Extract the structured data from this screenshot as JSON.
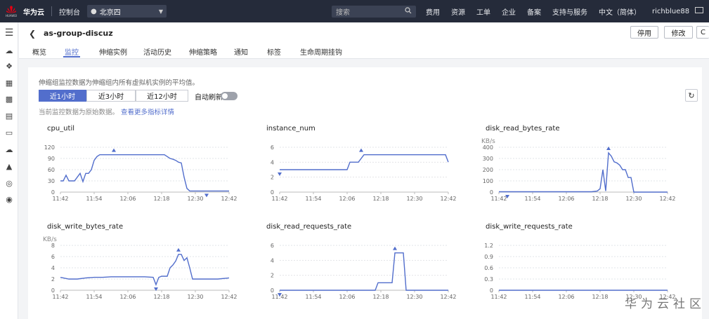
{
  "topbar": {
    "logo_text": "HUAWEI",
    "brand": "华为云",
    "console": "控制台",
    "region": "北京四",
    "search_placeholder": "搜索",
    "nav": [
      "费用",
      "资源",
      "工单",
      "企业",
      "备案",
      "支持与服务",
      "中文（简体）",
      "richblue88"
    ]
  },
  "header": {
    "group_name": "as-group-discuz",
    "stop_label": "停用",
    "edit_label": "修改",
    "tabs": [
      "概览",
      "监控",
      "伸缩实例",
      "活动历史",
      "伸缩策略",
      "通知",
      "标签",
      "生命周期挂钩"
    ],
    "active_tab": "监控"
  },
  "monitor": {
    "description": "伸缩组监控数据为伸缩组内所有虚拟机实例的平均值。",
    "ranges": [
      "近1小时",
      "近3小时",
      "近12小时"
    ],
    "active_range": "近1小时",
    "auto_refresh_label": "自动刷新",
    "auto_refresh_on": false,
    "note": "当前监控数据为原始数据。",
    "note_link": "查看更多指标详情"
  },
  "watermark": "华为云社区",
  "chart_data": [
    {
      "type": "line",
      "title": "cpu_util",
      "ylabel": "",
      "x_ticks": [
        "11:42",
        "11:54",
        "12:06",
        "12:18",
        "12:30",
        "12:42"
      ],
      "y_ticks": [
        "0",
        "30",
        "60",
        "90",
        "120"
      ],
      "ylim": [
        0,
        120
      ],
      "xlim": [
        0,
        60
      ],
      "series": [
        {
          "name": "",
          "color": "#526ecc",
          "x": [
            0,
            1,
            2,
            3,
            4,
            5,
            6,
            7,
            8,
            9,
            10,
            11,
            12,
            13,
            14,
            15,
            16,
            17,
            18,
            19,
            20,
            21,
            22,
            23,
            24,
            25,
            26,
            27,
            28,
            29,
            30,
            31,
            32,
            33,
            34,
            35,
            36,
            37,
            38,
            39,
            40,
            41,
            42,
            43,
            44,
            45,
            46,
            47,
            48,
            49,
            50,
            51,
            52,
            53,
            54,
            55,
            56,
            57,
            58,
            59,
            60
          ],
          "y": [
            30,
            30,
            45,
            30,
            30,
            30,
            40,
            50,
            28,
            50,
            50,
            60,
            85,
            95,
            100,
            100,
            100,
            100,
            100,
            100,
            100,
            100,
            100,
            100,
            100,
            100,
            100,
            100,
            100,
            100,
            100,
            100,
            100,
            100,
            100,
            100,
            100,
            100,
            95,
            90,
            88,
            85,
            80,
            78,
            40,
            10,
            3,
            3,
            3,
            3,
            3,
            3,
            3,
            3,
            3,
            3,
            3,
            3,
            3,
            3,
            3
          ]
        }
      ],
      "max_marker_x": 19,
      "min_marker_x": 52
    },
    {
      "type": "line",
      "title": "instance_num",
      "ylabel": "",
      "x_ticks": [
        "11:42",
        "11:54",
        "12:06",
        "12:18",
        "12:30",
        "12:42"
      ],
      "y_ticks": [
        "0",
        "2",
        "4",
        "6"
      ],
      "ylim": [
        0,
        6
      ],
      "xlim": [
        0,
        60
      ],
      "series": [
        {
          "name": "",
          "color": "#526ecc",
          "x": [
            0,
            5,
            10,
            15,
            20,
            24,
            25,
            26,
            27,
            28,
            30,
            35,
            40,
            45,
            50,
            55,
            59,
            60
          ],
          "y": [
            3,
            3,
            3,
            3,
            3,
            3,
            4,
            4,
            4,
            4,
            5,
            5,
            5,
            5,
            5,
            5,
            5,
            4
          ]
        }
      ],
      "max_marker_x": 29,
      "min_marker_x": 0
    },
    {
      "type": "line",
      "title": "disk_read_bytes_rate",
      "ylabel": "KB/s",
      "x_ticks": [
        "11:42",
        "11:54",
        "12:06",
        "12:18",
        "12:30",
        "12:42"
      ],
      "y_ticks": [
        "0",
        "100",
        "200",
        "300",
        "400"
      ],
      "ylim": [
        0,
        400
      ],
      "xlim": [
        0,
        60
      ],
      "series": [
        {
          "name": "",
          "color": "#526ecc",
          "x": [
            0,
            5,
            10,
            15,
            20,
            25,
            30,
            33,
            35,
            36,
            37,
            38,
            39,
            40,
            41,
            42,
            43,
            44,
            45,
            46,
            47,
            48,
            50,
            55,
            60
          ],
          "y": [
            3,
            3,
            3,
            3,
            3,
            3,
            3,
            3,
            10,
            30,
            200,
            10,
            350,
            320,
            270,
            260,
            240,
            200,
            200,
            130,
            130,
            0,
            0,
            0,
            0
          ]
        }
      ],
      "max_marker_x": 39,
      "min_marker_x": 3
    },
    {
      "type": "line",
      "title": "disk_write_bytes_rate",
      "ylabel": "KB/s",
      "x_ticks": [
        "11:42",
        "11:54",
        "12:06",
        "12:18",
        "12:30",
        "12:42"
      ],
      "y_ticks": [
        "0",
        "2",
        "4",
        "6",
        "8"
      ],
      "ylim": [
        0,
        8
      ],
      "xlim": [
        0,
        60
      ],
      "series": [
        {
          "name": "",
          "color": "#526ecc",
          "x": [
            0,
            3,
            6,
            9,
            12,
            15,
            18,
            21,
            24,
            27,
            30,
            33,
            34,
            35,
            36,
            37,
            38,
            39,
            40,
            41,
            42,
            43,
            44,
            45,
            46,
            47,
            50,
            53,
            56,
            60
          ],
          "y": [
            2.3,
            2.0,
            2.0,
            2.2,
            2.3,
            2.3,
            2.4,
            2.4,
            2.4,
            2.4,
            2.4,
            2.3,
            1.0,
            2.3,
            2.5,
            2.5,
            2.5,
            4.0,
            4.5,
            5.2,
            6.4,
            6.4,
            5.3,
            5.8,
            4.0,
            2.0,
            2.0,
            2.0,
            2.0,
            2.2
          ]
        }
      ],
      "max_marker_x": 42,
      "min_marker_x": 34
    },
    {
      "type": "line",
      "title": "disk_read_requests_rate",
      "ylabel": "",
      "x_ticks": [
        "11:42",
        "11:54",
        "12:06",
        "12:18",
        "12:30",
        "12:42"
      ],
      "y_ticks": [
        "0",
        "2",
        "4",
        "6"
      ],
      "ylim": [
        0,
        6
      ],
      "xlim": [
        0,
        60
      ],
      "series": [
        {
          "name": "",
          "color": "#526ecc",
          "x": [
            0,
            10,
            20,
            30,
            34,
            35,
            37,
            39,
            40,
            41,
            42,
            43,
            44,
            45,
            50,
            55,
            60
          ],
          "y": [
            0,
            0,
            0,
            0,
            0,
            1,
            1,
            1,
            1,
            5,
            5,
            5,
            5,
            0,
            0,
            0,
            0
          ]
        }
      ],
      "max_marker_x": 41,
      "min_marker_x": 0
    },
    {
      "type": "line",
      "title": "disk_write_requests_rate",
      "ylabel": "",
      "x_ticks": [
        "11:42",
        "11:54",
        "12:06",
        "12:18",
        "12:30",
        "12:42"
      ],
      "y_ticks": [
        "0",
        "0.3",
        "0.6",
        "0.9",
        "1.2"
      ],
      "ylim": [
        0,
        1.2
      ],
      "xlim": [
        0,
        60
      ],
      "series": [
        {
          "name": "",
          "color": "#526ecc",
          "x": [
            0,
            10,
            20,
            30,
            40,
            50,
            60
          ],
          "y": [
            0,
            0,
            0,
            0,
            0,
            0,
            0
          ]
        }
      ],
      "max_marker_x": null,
      "min_marker_x": null
    }
  ]
}
